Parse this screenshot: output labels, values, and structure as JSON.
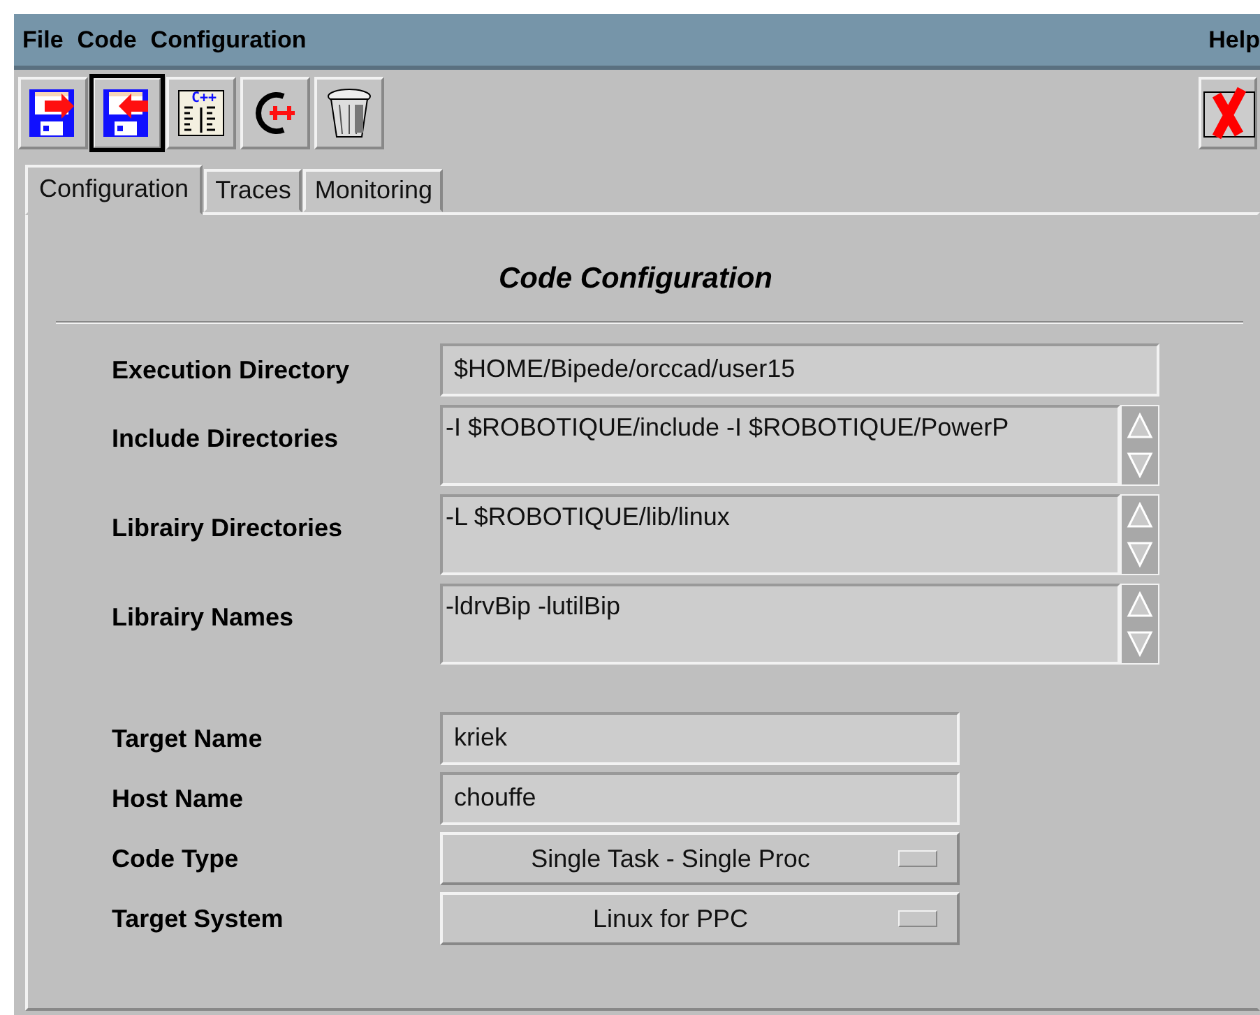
{
  "menubar": {
    "items": [
      {
        "label": "File"
      },
      {
        "label": "Code"
      },
      {
        "label": "Configuration"
      }
    ],
    "help": "Help"
  },
  "toolbar": {
    "buttons": [
      {
        "kind": "floppy-out",
        "focused": false
      },
      {
        "kind": "floppy-in",
        "focused": true
      },
      {
        "kind": "cpp-doc",
        "focused": false,
        "label": "C++"
      },
      {
        "kind": "c-arrow",
        "focused": false
      },
      {
        "kind": "trash",
        "focused": false
      }
    ],
    "close": {
      "kind": "close"
    }
  },
  "tabs": [
    {
      "label": "Configuration",
      "selected": true
    },
    {
      "label": "Traces",
      "selected": false
    },
    {
      "label": "Monitoring",
      "selected": false
    }
  ],
  "panel": {
    "title": "Code Configuration",
    "sections": [
      {
        "fields": [
          {
            "kind": "text",
            "label": "Execution Directory",
            "value": "$HOME/Bipede/orccad/user15"
          },
          {
            "kind": "textarea",
            "label": "Include Directories",
            "value": "-I $ROBOTIQUE/include -I $ROBOTIQUE/PowerP"
          },
          {
            "kind": "textarea",
            "label": "Librairy Directories",
            "value": "-L $ROBOTIQUE/lib/linux"
          },
          {
            "kind": "textarea",
            "label": "Librairy Names",
            "value": "-ldrvBip -lutilBip"
          }
        ]
      },
      {
        "fields": [
          {
            "kind": "text",
            "label": "Target Name",
            "value": "kriek"
          },
          {
            "kind": "text",
            "label": "Host Name",
            "value": "chouffe"
          },
          {
            "kind": "option",
            "label": "Code Type",
            "value": "Single Task - Single Proc"
          },
          {
            "kind": "option",
            "label": "Target System",
            "value": "Linux for PPC"
          }
        ]
      }
    ]
  }
}
